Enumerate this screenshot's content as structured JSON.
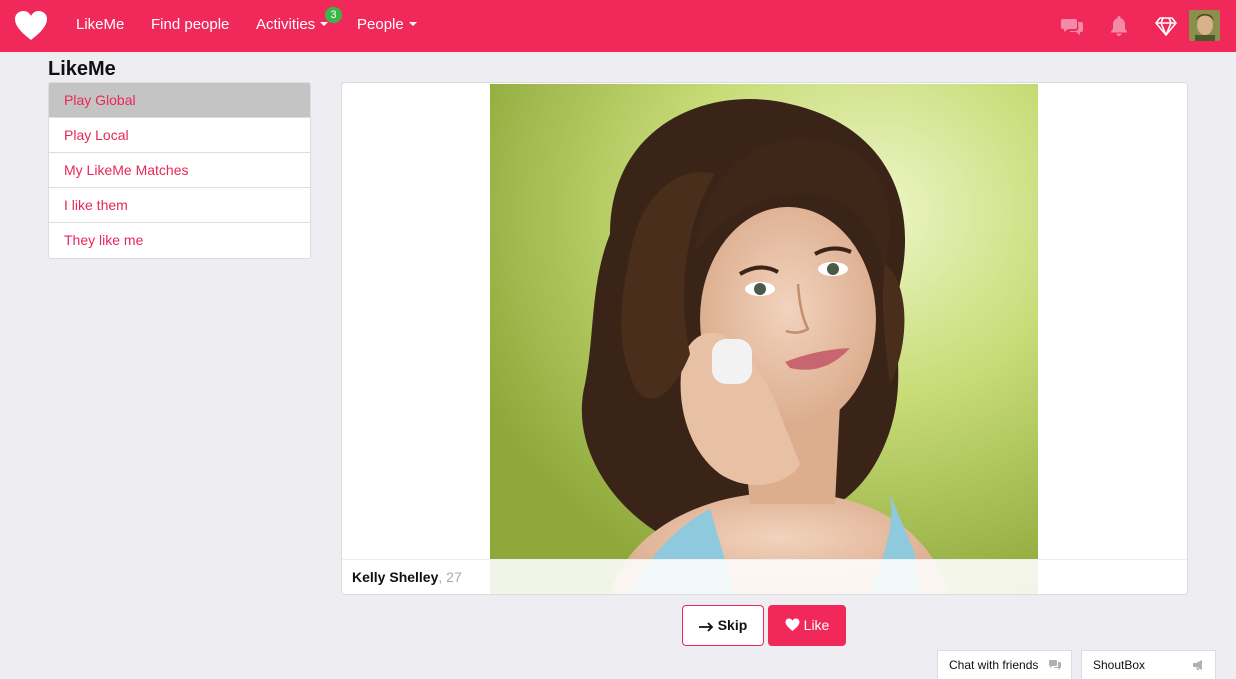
{
  "nav": {
    "links": [
      "LikeMe",
      "Find people",
      "Activities",
      "People"
    ],
    "activities_badge": "3",
    "accent_color": "#f1285a"
  },
  "page": {
    "title": "LikeMe"
  },
  "sidebar": {
    "items": [
      {
        "label": "Play Global",
        "active": true
      },
      {
        "label": "Play Local"
      },
      {
        "label": "My LikeMe Matches"
      },
      {
        "label": "I like them"
      },
      {
        "label": "They like me"
      }
    ]
  },
  "profile": {
    "name": "Kelly Shelley",
    "age_suffix": ", 27"
  },
  "actions": {
    "skip_label": "Skip",
    "like_label": "Like"
  },
  "dock": {
    "chat_label": "Chat with friends",
    "shoutbox_label": "ShoutBox"
  },
  "icons": [
    "heart-logo-icon",
    "chat-bubbles-icon",
    "bell-icon",
    "diamond-icon",
    "arrow-right-icon",
    "heart-icon",
    "megaphone-icon"
  ]
}
